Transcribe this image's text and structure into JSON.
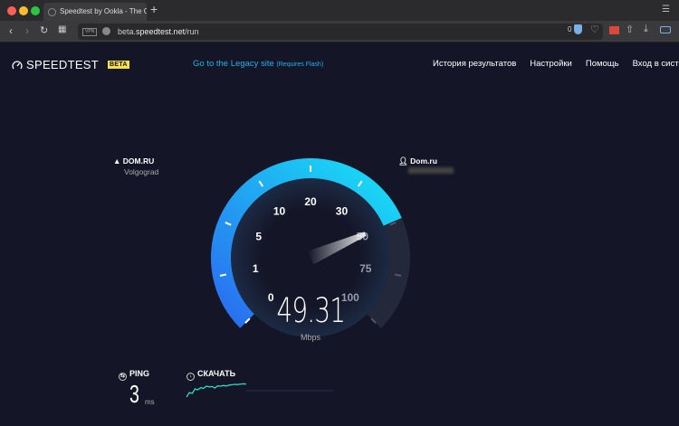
{
  "browser": {
    "tab_title": "Speedtest by Ookla - The Gl",
    "url_prefix": "beta.",
    "url_domain": "speedtest.net",
    "url_path": "/run",
    "vpn_label": "VPN",
    "blocked_count": "0"
  },
  "header": {
    "logo": "SPEEDTEST",
    "beta": "BETA",
    "legacy_link": "Go to the Legacy site",
    "legacy_note": "(Requires Flash)",
    "nav": [
      "История результатов",
      "Настройки",
      "Помощь",
      "Вход в систе"
    ]
  },
  "server": {
    "isp": "DOM.RU",
    "city": "Volgograd"
  },
  "client": {
    "isp": "Dom.ru"
  },
  "gauge": {
    "labels": [
      "0",
      "1",
      "5",
      "10",
      "20",
      "30",
      "50",
      "75",
      "100"
    ],
    "value": 49.31,
    "value_text": "49.31",
    "unit": "Mbps",
    "colors": {
      "start": "#2a6cf0",
      "end": "#18e0f5",
      "track": "#23283a"
    }
  },
  "ping": {
    "label": "PING",
    "value": "3",
    "unit": "ms"
  },
  "download": {
    "label": "СКАЧАТЬ",
    "graph": [
      0.1,
      0.35,
      0.3,
      0.55,
      0.5,
      0.62,
      0.58,
      0.7,
      0.66,
      0.68,
      0.6,
      0.72,
      0.7,
      0.74,
      0.71,
      0.76,
      0.78,
      0.8,
      0.79,
      0.82,
      0.83,
      0.82
    ]
  }
}
